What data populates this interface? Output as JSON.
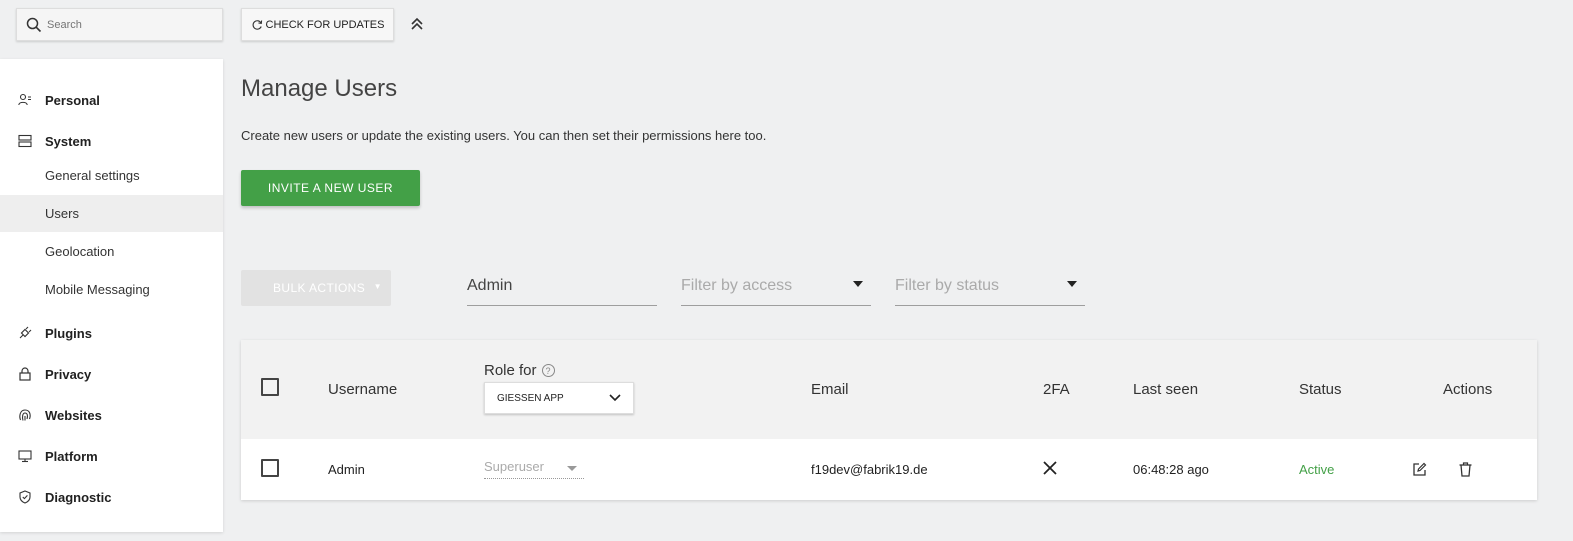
{
  "search": {
    "placeholder": "Search"
  },
  "toolbar": {
    "check_updates_label": "CHECK FOR UPDATES"
  },
  "sidebar": {
    "sections": [
      {
        "label": "Personal",
        "icon": "user-icon"
      },
      {
        "label": "System",
        "icon": "server-icon"
      },
      {
        "label": "Plugins",
        "icon": "plug-icon"
      },
      {
        "label": "Privacy",
        "icon": "lock-icon"
      },
      {
        "label": "Websites",
        "icon": "fingerprint-icon"
      },
      {
        "label": "Platform",
        "icon": "monitor-icon"
      },
      {
        "label": "Diagnostic",
        "icon": "shield-icon"
      }
    ],
    "system_items": [
      {
        "label": "General settings"
      },
      {
        "label": "Users",
        "active": true
      },
      {
        "label": "Geolocation"
      },
      {
        "label": "Mobile Messaging"
      }
    ]
  },
  "main": {
    "title": "Manage Users",
    "description": "Create new users or update the existing users. You can then set their permissions here too.",
    "invite_label": "INVITE A NEW USER",
    "bulk_actions_label": "BULK ACTIONS",
    "filters": {
      "text_value": "Admin",
      "access_placeholder": "Filter by access",
      "status_placeholder": "Filter by status"
    }
  },
  "table": {
    "headers": {
      "username": "Username",
      "role_for": "Role for",
      "role_site": "GIESSEN APP",
      "email": "Email",
      "twofa": "2FA",
      "last_seen": "Last seen",
      "status": "Status",
      "actions": "Actions"
    },
    "rows": [
      {
        "username": "Admin",
        "role": "Superuser",
        "email": "f19dev@fabrik19.de",
        "twofa": "disabled",
        "last_seen": "06:48:28 ago",
        "status": "Active"
      }
    ]
  },
  "colors": {
    "accent": "#43a047",
    "background": "#eff0f1"
  }
}
